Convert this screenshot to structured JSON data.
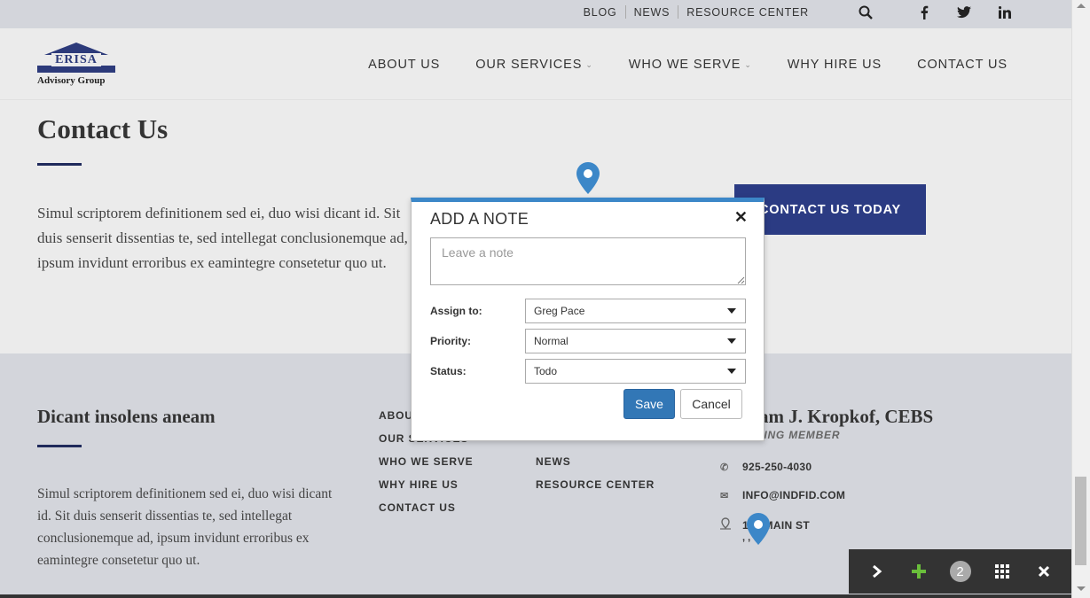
{
  "topbar": {
    "links": [
      "BLOG",
      "NEWS",
      "RESOURCE CENTER"
    ],
    "icons": [
      "search-icon",
      "facebook-icon",
      "twitter-icon",
      "linkedin-icon"
    ]
  },
  "header": {
    "logo_top": "ERISA",
    "logo_sub": "Advisory Group",
    "nav": {
      "about": "ABOUT US",
      "services": "OUR SERVICES",
      "who": "WHO WE SERVE",
      "why": "WHY HIRE US",
      "contact": "CONTACT US"
    }
  },
  "main": {
    "title": "Contact Us",
    "body": "Simul scriptorem definitionem sed ei, duo wisi dicant id. Sit duis senserit dissentias te, sed intellegat conclusionemque ad, ipsum invidunt erroribus ex eamintegre consetetur quo ut.",
    "cta": "CONTACT US TODAY"
  },
  "footer": {
    "col1_title": "Dicant insolens aneam",
    "col1_body": "Simul scriptorem definitionem sed ei, duo wisi dicant id. Sit duis senserit dissentias te, sed intellegat conclusionemque ad, ipsum invidunt erroribus ex eamintegre consetetur quo ut.",
    "links_col1": [
      "ABOUT US",
      "OUR SERVICES",
      "WHO WE SERVE",
      "WHY HIRE US",
      "CONTACT US"
    ],
    "links_col2": [
      "NEWS",
      "RESOURCE CENTER"
    ],
    "person_name": "William J. Kropkof, CEBS",
    "person_role": "MANAGING MEMBER",
    "phone": "925-250-4030",
    "email": "INFO@INDFID.COM",
    "address": "123 MAIN ST",
    "address2": ", ,"
  },
  "modal": {
    "title": "ADD A NOTE",
    "note_placeholder": "Leave a note",
    "assign_label": "Assign to:",
    "assign_value": "Greg Pace",
    "priority_label": "Priority:",
    "priority_value": "Normal",
    "status_label": "Status:",
    "status_value": "Todo",
    "save": "Save",
    "cancel": "Cancel"
  },
  "toolbar": {
    "badge_count": "2",
    "icons": [
      "chevron-right-icon",
      "plus-icon",
      "grid-icon",
      "close-icon"
    ]
  },
  "colors": {
    "accent": "#3c87c8",
    "brand": "#2b3b83",
    "plus_green": "#6abf3b"
  }
}
